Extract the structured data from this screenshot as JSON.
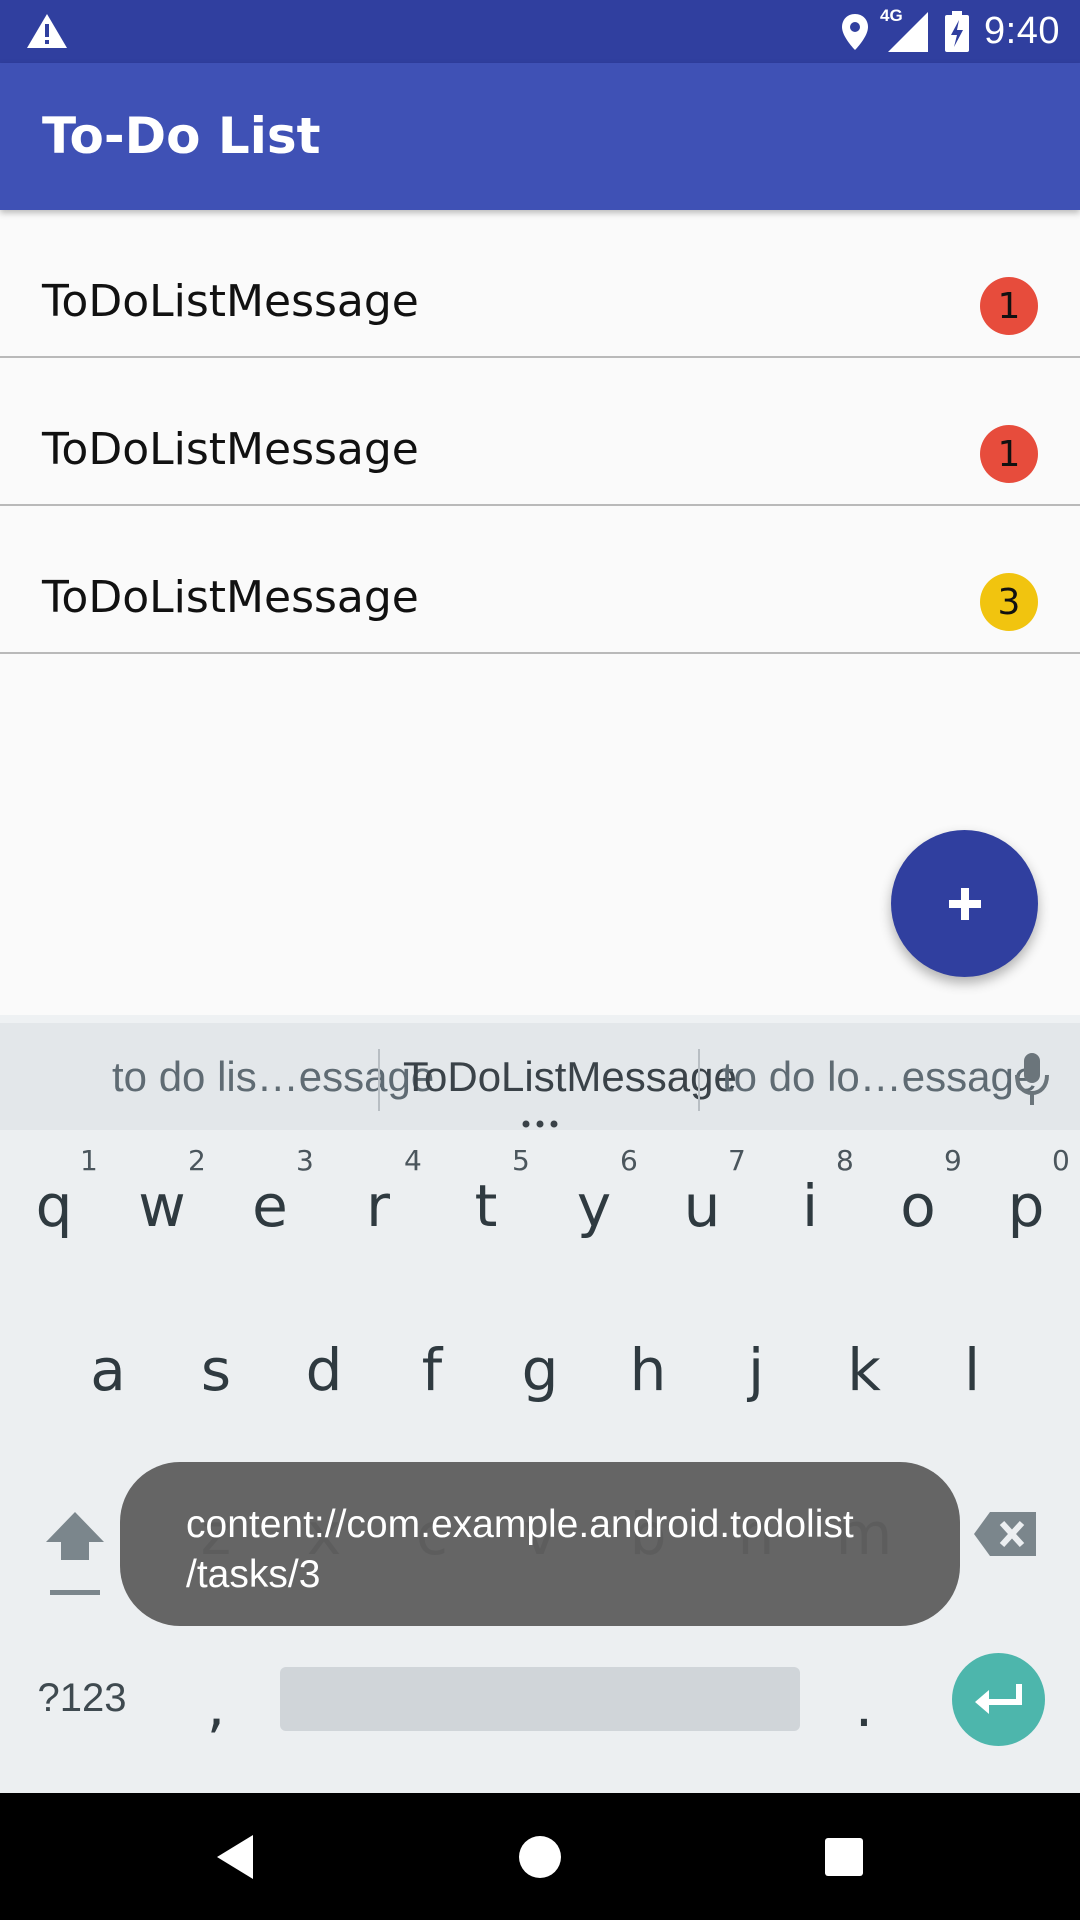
{
  "status_bar": {
    "network": "4G",
    "time": "9:40",
    "icons": [
      "warning-icon",
      "location-icon",
      "signal-icon",
      "battery-charging-icon"
    ]
  },
  "app_bar": {
    "title": "To-Do List"
  },
  "tasks": [
    {
      "message": "ToDoListMessage",
      "priority": "1",
      "color": "#e74c3c"
    },
    {
      "message": "ToDoListMessage",
      "priority": "1",
      "color": "#e74c3c"
    },
    {
      "message": "ToDoListMessage",
      "priority": "3",
      "color": "#f1c40f"
    }
  ],
  "fab": {
    "icon": "plus-icon",
    "color": "#303f9f"
  },
  "keyboard": {
    "suggestions": [
      "to do lis…essage",
      "ToDoListMessage",
      "to do lo…essage"
    ],
    "row1": [
      "q",
      "w",
      "e",
      "r",
      "t",
      "y",
      "u",
      "i",
      "o",
      "p"
    ],
    "row1_hints": [
      "1",
      "2",
      "3",
      "4",
      "5",
      "6",
      "7",
      "8",
      "9",
      "0"
    ],
    "row2": [
      "a",
      "s",
      "d",
      "f",
      "g",
      "h",
      "j",
      "k",
      "l"
    ],
    "row3": [
      "z",
      "x",
      "c",
      "v",
      "b",
      "n",
      "m"
    ],
    "symbols_key": "?123",
    "comma_key": ",",
    "period_key": ".",
    "enter_color": "#4db6ac"
  },
  "toast": {
    "line1": "content://com.example.android.todolist",
    "line2": "/tasks/3"
  },
  "nav_bar": {
    "buttons": [
      "back-icon",
      "home-icon",
      "recents-icon"
    ]
  }
}
